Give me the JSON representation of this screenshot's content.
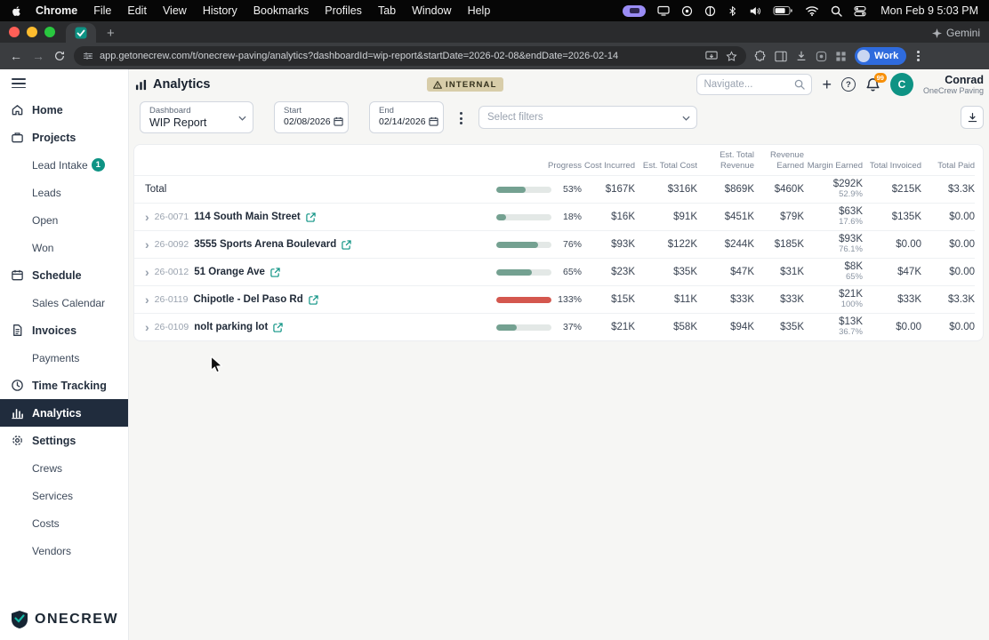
{
  "colors": {
    "accent": "#0e9384",
    "progress_fill": "#74a191",
    "progress_over": "#d4574e",
    "progress_track": "#e3e8e6",
    "sidebar_active_bg": "#202c3d",
    "internal_badge_bg": "#d8cda9",
    "work_chip_bg": "#2f6bdd",
    "bell_badge_bg": "#f79009",
    "lead_badge_bg": "#0e9384",
    "recording_pill_bg": "#9a8cf5"
  },
  "menubar": {
    "items": [
      "Chrome",
      "File",
      "Edit",
      "View",
      "History",
      "Bookmarks",
      "Profiles",
      "Tab",
      "Window",
      "Help"
    ],
    "clock": "Mon Feb 9 5:03 PM"
  },
  "browser": {
    "gemini_label": "Gemini",
    "url": "app.getonecrew.com/t/onecrew-paving/analytics?dashboardId=wip-report&startDate=2026-02-08&endDate=2026-02-14",
    "profile_label": "Work"
  },
  "sidebar": {
    "items": [
      {
        "label": "Home"
      },
      {
        "label": "Projects"
      },
      {
        "label": "Lead Intake",
        "badge": "1"
      },
      {
        "label": "Leads"
      },
      {
        "label": "Open"
      },
      {
        "label": "Won"
      },
      {
        "label": "Schedule"
      },
      {
        "label": "Sales Calendar"
      },
      {
        "label": "Invoices"
      },
      {
        "label": "Payments"
      },
      {
        "label": "Time Tracking"
      },
      {
        "label": "Analytics"
      },
      {
        "label": "Settings"
      },
      {
        "label": "Crews"
      },
      {
        "label": "Services"
      },
      {
        "label": "Costs"
      },
      {
        "label": "Vendors"
      }
    ],
    "logo_text": "ONECREW"
  },
  "header": {
    "title": "Analytics",
    "internal_badge": "INTERNAL",
    "navigate_placeholder": "Navigate...",
    "bell_badge": "99",
    "user_name": "Conrad",
    "user_org": "OneCrew Paving",
    "avatar_initial": "C"
  },
  "filters": {
    "dashboard_label": "Dashboard",
    "dashboard_value": "WIP Report",
    "start_label": "Start",
    "start_value": "02/08/2026",
    "end_label": "End",
    "end_value": "02/14/2026",
    "filters_placeholder": "Select filters"
  },
  "table": {
    "columns": {
      "progress": "Progress",
      "cost_incurred": "Cost Incurred",
      "est_total_cost": "Est. Total Cost",
      "est_total_revenue": "Est. Total Revenue",
      "revenue_earned": "Revenue Earned",
      "margin_earned": "Margin Earned",
      "total_invoiced": "Total Invoiced",
      "total_paid": "Total Paid"
    },
    "total_row": {
      "label": "Total",
      "progress_pct": 53,
      "progress_label": "53%",
      "bar_color": "#74a191",
      "cost_incurred": "$167K",
      "est_total_cost": "$316K",
      "est_total_revenue": "$869K",
      "revenue_earned": "$460K",
      "margin_earned": "$292K",
      "margin_earned_pct": "52.9%",
      "total_invoiced": "$215K",
      "total_paid": "$3.3K"
    },
    "rows": [
      {
        "code": "26-0071",
        "name": "114 South Main Street",
        "progress_pct": 18,
        "progress_label": "18%",
        "bar_color": "#74a191",
        "cost_incurred": "$16K",
        "est_total_cost": "$91K",
        "est_total_revenue": "$451K",
        "revenue_earned": "$79K",
        "margin_earned": "$63K",
        "margin_earned_pct": "17.6%",
        "total_invoiced": "$135K",
        "total_paid": "$0.00"
      },
      {
        "code": "26-0092",
        "name": "3555 Sports Arena Boulevard",
        "progress_pct": 76,
        "progress_label": "76%",
        "bar_color": "#74a191",
        "cost_incurred": "$93K",
        "est_total_cost": "$122K",
        "est_total_revenue": "$244K",
        "revenue_earned": "$185K",
        "margin_earned": "$93K",
        "margin_earned_pct": "76.1%",
        "total_invoiced": "$0.00",
        "total_paid": "$0.00"
      },
      {
        "code": "26-0012",
        "name": "51 Orange Ave",
        "progress_pct": 65,
        "progress_label": "65%",
        "bar_color": "#74a191",
        "cost_incurred": "$23K",
        "est_total_cost": "$35K",
        "est_total_revenue": "$47K",
        "revenue_earned": "$31K",
        "margin_earned": "$8K",
        "margin_earned_pct": "65%",
        "total_invoiced": "$47K",
        "total_paid": "$0.00"
      },
      {
        "code": "26-0119",
        "name": "Chipotle - Del Paso Rd",
        "progress_pct": 133,
        "progress_label": "133%",
        "bar_color": "#d4574e",
        "cost_incurred": "$15K",
        "est_total_cost": "$11K",
        "est_total_revenue": "$33K",
        "revenue_earned": "$33K",
        "margin_earned": "$21K",
        "margin_earned_pct": "100%",
        "total_invoiced": "$33K",
        "total_paid": "$3.3K"
      },
      {
        "code": "26-0109",
        "name": "nolt parking lot",
        "progress_pct": 37,
        "progress_label": "37%",
        "bar_color": "#74a191",
        "cost_incurred": "$21K",
        "est_total_cost": "$58K",
        "est_total_revenue": "$94K",
        "revenue_earned": "$35K",
        "margin_earned": "$13K",
        "margin_earned_pct": "36.7%",
        "total_invoiced": "$0.00",
        "total_paid": "$0.00"
      }
    ]
  }
}
